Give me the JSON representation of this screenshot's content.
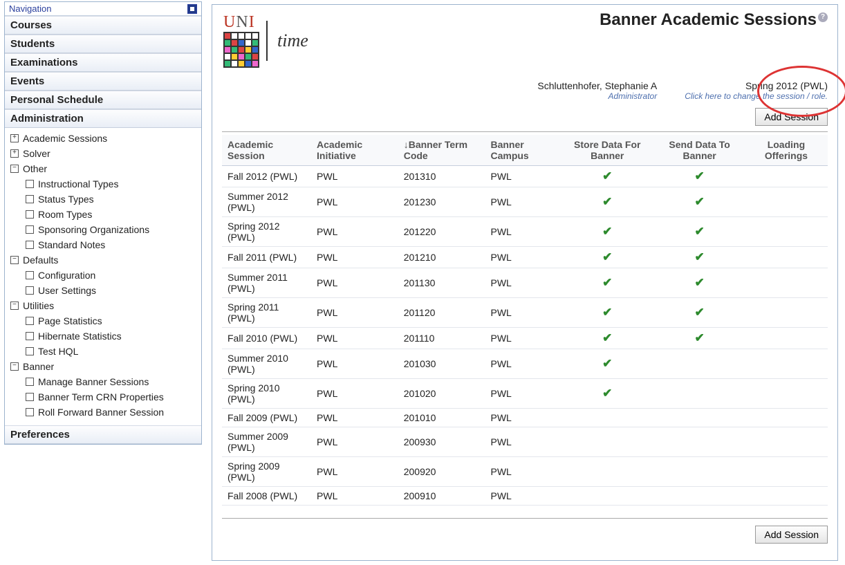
{
  "nav": {
    "title": "Navigation",
    "sections": [
      "Courses",
      "Students",
      "Examinations",
      "Events",
      "Personal Schedule",
      "Administration"
    ],
    "admin_tree": {
      "academic_sessions": "Academic Sessions",
      "solver": "Solver",
      "other": "Other",
      "other_children": [
        "Instructional Types",
        "Status Types",
        "Room Types",
        "Sponsoring Organizations",
        "Standard Notes"
      ],
      "defaults": "Defaults",
      "defaults_children": [
        "Configuration",
        "User Settings"
      ],
      "utilities": "Utilities",
      "utilities_children": [
        "Page Statistics",
        "Hibernate Statistics",
        "Test HQL"
      ],
      "banner": "Banner",
      "banner_children": [
        "Manage Banner Sessions",
        "Banner Term CRN Properties",
        "Roll Forward Banner Session"
      ]
    },
    "preferences": "Preferences"
  },
  "page": {
    "title": "Banner Academic Sessions",
    "user_name": "Schluttenhofer, Stephanie A",
    "user_role": "Administrator",
    "session": "Spring 2012 (PWL)",
    "session_hint": "Click here to change the session / role.",
    "add_session": "Add Session"
  },
  "table": {
    "headers": {
      "session": "Academic Session",
      "initiative": "Academic Initiative",
      "term": "↓Banner Term Code",
      "campus": "Banner Campus",
      "store": "Store Data For Banner",
      "send": "Send Data To Banner",
      "loading": "Loading Offerings"
    },
    "rows": [
      {
        "session": "Fall 2012 (PWL)",
        "initiative": "PWL",
        "term": "201310",
        "campus": "PWL",
        "store": true,
        "send": true,
        "loading": false
      },
      {
        "session": "Summer 2012 (PWL)",
        "initiative": "PWL",
        "term": "201230",
        "campus": "PWL",
        "store": true,
        "send": true,
        "loading": false
      },
      {
        "session": "Spring 2012 (PWL)",
        "initiative": "PWL",
        "term": "201220",
        "campus": "PWL",
        "store": true,
        "send": true,
        "loading": false
      },
      {
        "session": "Fall 2011 (PWL)",
        "initiative": "PWL",
        "term": "201210",
        "campus": "PWL",
        "store": true,
        "send": true,
        "loading": false
      },
      {
        "session": "Summer 2011 (PWL)",
        "initiative": "PWL",
        "term": "201130",
        "campus": "PWL",
        "store": true,
        "send": true,
        "loading": false
      },
      {
        "session": "Spring 2011 (PWL)",
        "initiative": "PWL",
        "term": "201120",
        "campus": "PWL",
        "store": true,
        "send": true,
        "loading": false
      },
      {
        "session": "Fall 2010 (PWL)",
        "initiative": "PWL",
        "term": "201110",
        "campus": "PWL",
        "store": true,
        "send": true,
        "loading": false
      },
      {
        "session": "Summer 2010 (PWL)",
        "initiative": "PWL",
        "term": "201030",
        "campus": "PWL",
        "store": true,
        "send": false,
        "loading": false
      },
      {
        "session": "Spring 2010 (PWL)",
        "initiative": "PWL",
        "term": "201020",
        "campus": "PWL",
        "store": true,
        "send": false,
        "loading": false
      },
      {
        "session": "Fall 2009 (PWL)",
        "initiative": "PWL",
        "term": "201010",
        "campus": "PWL",
        "store": false,
        "send": false,
        "loading": false
      },
      {
        "session": "Summer 2009 (PWL)",
        "initiative": "PWL",
        "term": "200930",
        "campus": "PWL",
        "store": false,
        "send": false,
        "loading": false
      },
      {
        "session": "Spring 2009 (PWL)",
        "initiative": "PWL",
        "term": "200920",
        "campus": "PWL",
        "store": false,
        "send": false,
        "loading": false
      },
      {
        "session": "Fall 2008 (PWL)",
        "initiative": "PWL",
        "term": "200910",
        "campus": "PWL",
        "store": false,
        "send": false,
        "loading": false
      }
    ]
  },
  "logo_colors": [
    "#d44",
    "#fff",
    "#fff",
    "#fff",
    "#fff",
    "#3b7",
    "#d44",
    "#36c",
    "#fff",
    "#3b7",
    "#e6c",
    "#3b7",
    "#d44",
    "#fc3",
    "#36c",
    "#fff",
    "#fc3",
    "#e6c",
    "#3b7",
    "#d44",
    "#3b7",
    "#fff",
    "#fc3",
    "#36c",
    "#e6c"
  ]
}
